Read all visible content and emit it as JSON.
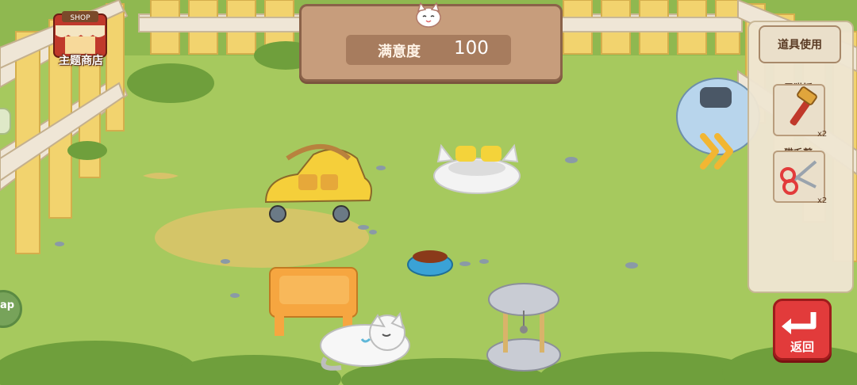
{
  "satisfaction": {
    "label": "满意度",
    "value": "100"
  },
  "shop": {
    "sign": "SHOP",
    "label": "主题商店"
  },
  "items_panel": {
    "title": "道具使用",
    "tools": [
      {
        "name": "震猫锤",
        "count": "x2",
        "icon": "hammer-icon"
      },
      {
        "name": "猫毛剪",
        "count": "x2",
        "icon": "scissors-icon"
      }
    ]
  },
  "return_button": {
    "label": "返回"
  },
  "map_tab": {
    "label": "ap"
  },
  "colors": {
    "grass": "#9cc45a",
    "fence": "#f0d36b",
    "wood": "#c79d7c",
    "return": "#e23b3b"
  }
}
